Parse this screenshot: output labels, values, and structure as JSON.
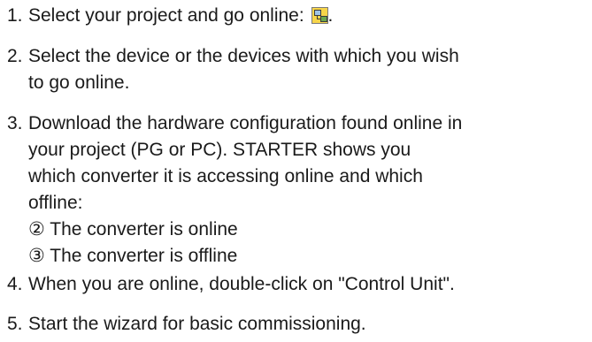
{
  "steps": [
    {
      "number": "1.",
      "lines": [
        "Select your project and go online: "
      ],
      "trailing": "."
    },
    {
      "number": "2.",
      "lines": [
        "Select the device or the devices with which you wish",
        "to go online."
      ]
    },
    {
      "number": "3.",
      "lines": [
        "Download the hardware configuration found online in",
        "your project (PG or PC). STARTER shows you",
        "which converter it is accessing online and which",
        "offline:",
        "② The converter is online",
        "③ The converter is offline"
      ]
    },
    {
      "number": "4.",
      "lines": [
        "When you are online, double-click on \"Control Unit\"."
      ]
    },
    {
      "number": "5.",
      "lines": [
        "Start the wizard for basic commissioning."
      ]
    }
  ],
  "icons": {
    "go_online": "go-online-icon"
  }
}
